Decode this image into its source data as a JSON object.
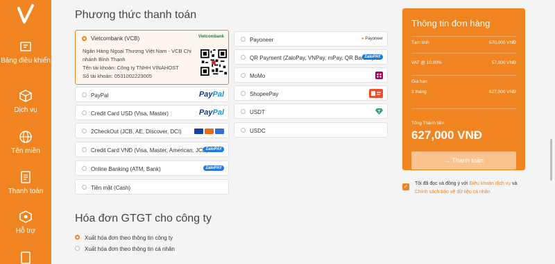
{
  "sidebar": {
    "items": [
      {
        "label": "Bảng điều khiển",
        "icon": "dashboard-icon"
      },
      {
        "label": "Dịch vụ",
        "icon": "box-icon"
      },
      {
        "label": "Tên miền",
        "icon": "globe-icon"
      },
      {
        "label": "Thanh toán",
        "icon": "billing-icon"
      },
      {
        "label": "Hỗ trợ",
        "icon": "support-icon"
      }
    ]
  },
  "payment": {
    "title": "Phương thức thanh toán",
    "vcb": {
      "label": "Vietcombank (VCB)",
      "logo_text": "Vietcombank",
      "bank_name": "Ngân Hàng Ngoại Thương Việt Nam - VCB Chi nhánh Bình Thạnh",
      "account_name": "Tên tài khoản: Công ty TNHH VINAHOST",
      "account_number": "Số tài khoản: 0531002223005"
    },
    "left": [
      {
        "label": "PayPal",
        "logo": "paypal"
      },
      {
        "label": "Credit Card USD (Visa, Master)",
        "logo": "paypal"
      },
      {
        "label": "2CheckOut (JCB, AE, Discover, DCI)",
        "logo": "cards"
      },
      {
        "label": "Credit Card VNĐ (Visa, Master, American, JCB)",
        "logo": "zalopay"
      },
      {
        "label": "Online Banking (ATM, Bank)",
        "logo": "zalopay"
      },
      {
        "label": "Tiền mặt (Cash)",
        "logo": "none"
      }
    ],
    "right": [
      {
        "label": "Payoneer",
        "logo": "payoneer"
      },
      {
        "label": "QR Payment (ZaloPay, VNPay, mPay, QR Bank...)",
        "logo": "zalopay"
      },
      {
        "label": "MoMo",
        "logo": "momo"
      },
      {
        "label": "ShopeePay",
        "logo": "shopeepay"
      },
      {
        "label": "USDT",
        "logo": "usdt"
      },
      {
        "label": "USDC",
        "logo": "none"
      }
    ],
    "logo_text": {
      "paypal_1": "Pay",
      "paypal_2": "Pal",
      "zalopay_1": "Zalo",
      "zalopay_2": "PAY",
      "payoneer": "Payoneer"
    }
  },
  "invoice": {
    "title": "Hóa đơn GTGT cho công ty",
    "options": [
      {
        "label": "Xuất hóa đơn theo thông tin công ty",
        "selected": true
      },
      {
        "label": "Xuất hóa đơn theo thông tin cá nhân",
        "selected": false
      }
    ]
  },
  "order": {
    "title": "Thông tin đơn hàng",
    "subtotal_label": "Tạm tính",
    "subtotal_value": "570,000 VNĐ",
    "vat_label": "VAT @ 10.00%",
    "vat_value": "57,000 VNĐ",
    "renew_label": "Gia hạn",
    "renew_term": "3 tháng",
    "renew_value": "627,000 VNĐ",
    "total_label": "Tổng Thành tiền",
    "total_value": "627,000 VNĐ",
    "pay_button": "→ Thanh toán"
  },
  "agreement": {
    "prefix": "Tôi đã đọc và đồng ý với ",
    "terms_link": "Điều khoản dịch vụ",
    "middle": " và ",
    "privacy_link": "Chính sách bảo vệ dữ liệu cá nhân"
  },
  "colors": {
    "brand": "#f08421",
    "text": "#333333"
  }
}
